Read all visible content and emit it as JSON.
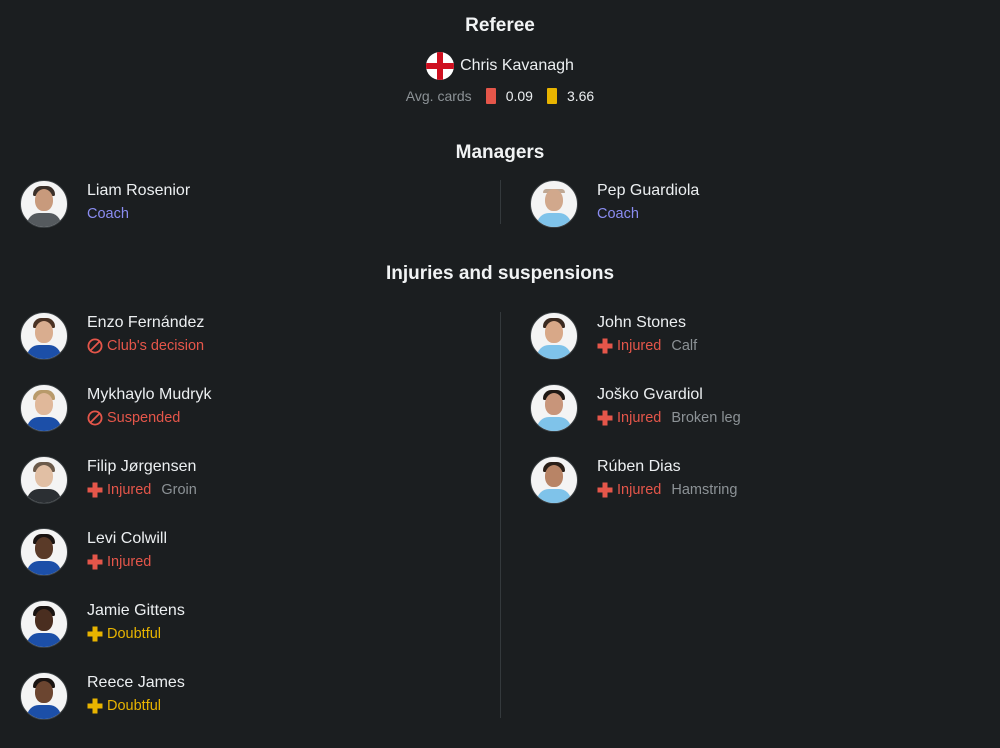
{
  "referee": {
    "title": "Referee",
    "name": "Chris Kavanagh",
    "flag_icon": "england-flag-icon",
    "avg_label": "Avg. cards",
    "red_avg": "0.09",
    "yellow_avg": "3.66"
  },
  "managers": {
    "title": "Managers",
    "home": {
      "name": "Liam Rosenior",
      "role": "Coach"
    },
    "away": {
      "name": "Pep Guardiola",
      "role": "Coach"
    }
  },
  "injuries": {
    "title": "Injuries and suspensions",
    "home": [
      {
        "name": "Enzo Fernández",
        "status": "Club's decision",
        "kind": "suspended",
        "detail": ""
      },
      {
        "name": "Mykhaylo Mudryk",
        "status": "Suspended",
        "kind": "suspended",
        "detail": ""
      },
      {
        "name": "Filip Jørgensen",
        "status": "Injured",
        "kind": "injured",
        "detail": "Groin"
      },
      {
        "name": "Levi Colwill",
        "status": "Injured",
        "kind": "injured",
        "detail": ""
      },
      {
        "name": "Jamie Gittens",
        "status": "Doubtful",
        "kind": "doubtful",
        "detail": ""
      },
      {
        "name": "Reece James",
        "status": "Doubtful",
        "kind": "doubtful",
        "detail": ""
      }
    ],
    "away": [
      {
        "name": "John Stones",
        "status": "Injured",
        "kind": "injured",
        "detail": "Calf"
      },
      {
        "name": "Joško Gvardiol",
        "status": "Injured",
        "kind": "injured",
        "detail": "Broken leg"
      },
      {
        "name": "Rúben Dias",
        "status": "Injured",
        "kind": "injured",
        "detail": "Hamstring"
      }
    ]
  },
  "colors": {
    "background": "#1b1e20",
    "red_status": "#e5564a",
    "yellow_status": "#e8b400",
    "coach_label": "#8a8cf0",
    "chelsea_kit": "#1c4fa8",
    "city_kit": "#7fc3ea"
  }
}
